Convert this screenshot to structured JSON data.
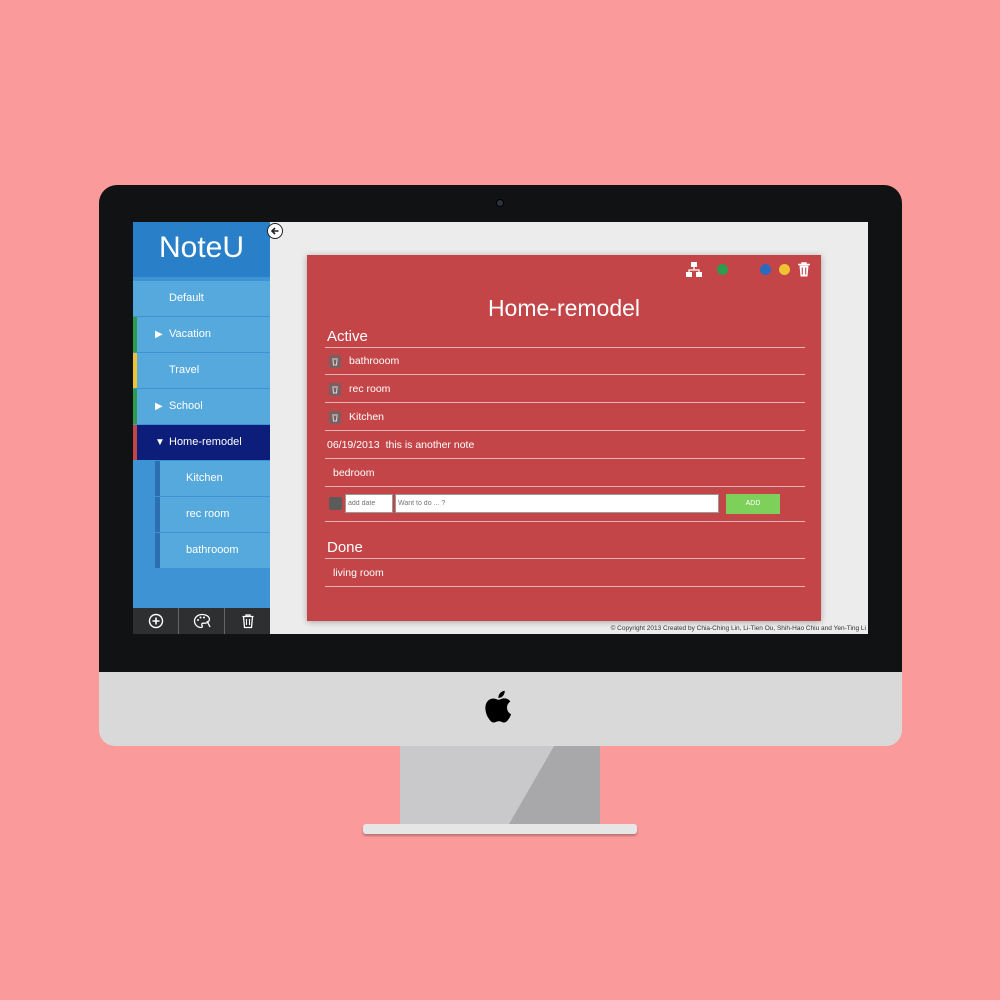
{
  "app": {
    "title": "NoteU"
  },
  "sidebar": {
    "items": [
      {
        "label": "Default",
        "accent": "#56a9dd"
      },
      {
        "label": "Vacation",
        "arrow": "▶",
        "accent": "#2e9b4d"
      },
      {
        "label": "Travel",
        "accent": "#f1c232"
      },
      {
        "label": "School",
        "arrow": "▶",
        "accent": "#2e9b4d"
      },
      {
        "label": "Home-remodel",
        "arrow": "▼",
        "accent": "#c44548",
        "active": true
      }
    ],
    "subitems": [
      {
        "label": "Kitchen"
      },
      {
        "label": "rec room"
      },
      {
        "label": "bathrooom"
      }
    ],
    "toolbar": [
      "add-circle-icon",
      "palette-icon",
      "trash-icon"
    ]
  },
  "note": {
    "title": "Home-remodel",
    "background": "#c44548",
    "color_dots": [
      "#2e9b4d",
      "#2a6bc0",
      "#f1c232"
    ],
    "active_heading": "Active",
    "active_items": [
      {
        "text": "bathrooom",
        "has_icon": true
      },
      {
        "text": "rec room",
        "has_icon": true
      },
      {
        "text": "Kitchen",
        "has_icon": true
      },
      {
        "date": "06/19/2013",
        "text": "this is another note"
      },
      {
        "text": "bedroom"
      }
    ],
    "add_form": {
      "date_placeholder": "add date",
      "todo_placeholder": "Want to do ... ?",
      "add_label": "ADD"
    },
    "done_heading": "Done",
    "done_items": [
      {
        "text": "living room"
      }
    ]
  },
  "footer": {
    "copyright": "© Copyright 2013 Created by Chia-Ching Lin, Li-Tien Ou, Shih-Hao Chiu and Yen-Ting Li"
  }
}
